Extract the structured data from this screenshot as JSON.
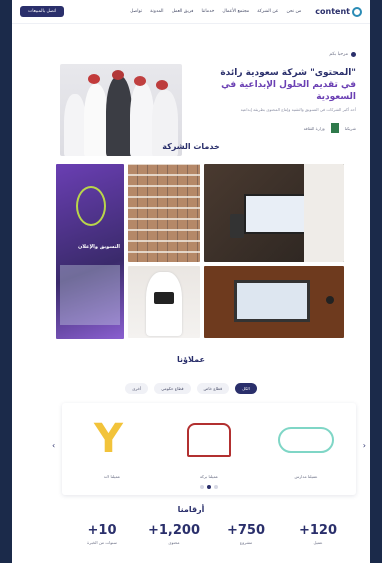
{
  "nav": {
    "logo_text": "content",
    "links": [
      "من نحن",
      "عن الشركة",
      "مجتمع الأعمال",
      "خدماتنا",
      "فريق العمل",
      "المدونة",
      "تواصل"
    ],
    "cta_label": "اتصل بالمبيعات"
  },
  "hero": {
    "badge": "مرحبا بكم",
    "headline": "\"المحتوى\" شركة سعودية رائدة",
    "headline_accent": "في تقديم الحلول الإبداعية في السعودية",
    "subtitle": "أحد أكبر الشركات في التسويق والتقنية وإنتاج المحتوى بطريقة إبداعية",
    "partners_label": "شريكنا",
    "partner_text": "وزارة الثقافة"
  },
  "services": {
    "title": "خدمات الشركة",
    "tile_caption": "التسويق والإعلان"
  },
  "clients": {
    "title": "عملاؤنا",
    "filters": [
      "الكل",
      "قطاع خاص",
      "قطاع حكومي",
      "أخرى"
    ],
    "items": [
      {
        "name": "عميلنا مدارس"
      },
      {
        "name": "عميلنا بركة"
      },
      {
        "name": "عميلنا لاند"
      }
    ],
    "active_dot": 1
  },
  "numbers": {
    "title": "أرقامنا",
    "stats": [
      {
        "value": "120+",
        "label": "عميل"
      },
      {
        "value": "750+",
        "label": "مشروع"
      },
      {
        "value": "1,200+",
        "label": "محتوى"
      },
      {
        "value": "10+",
        "label": "سنوات من الخبرة"
      }
    ]
  },
  "colors": {
    "primary": "#2a2f6b",
    "accent": "#6a3fb3",
    "frame": "#1b2a4a"
  }
}
